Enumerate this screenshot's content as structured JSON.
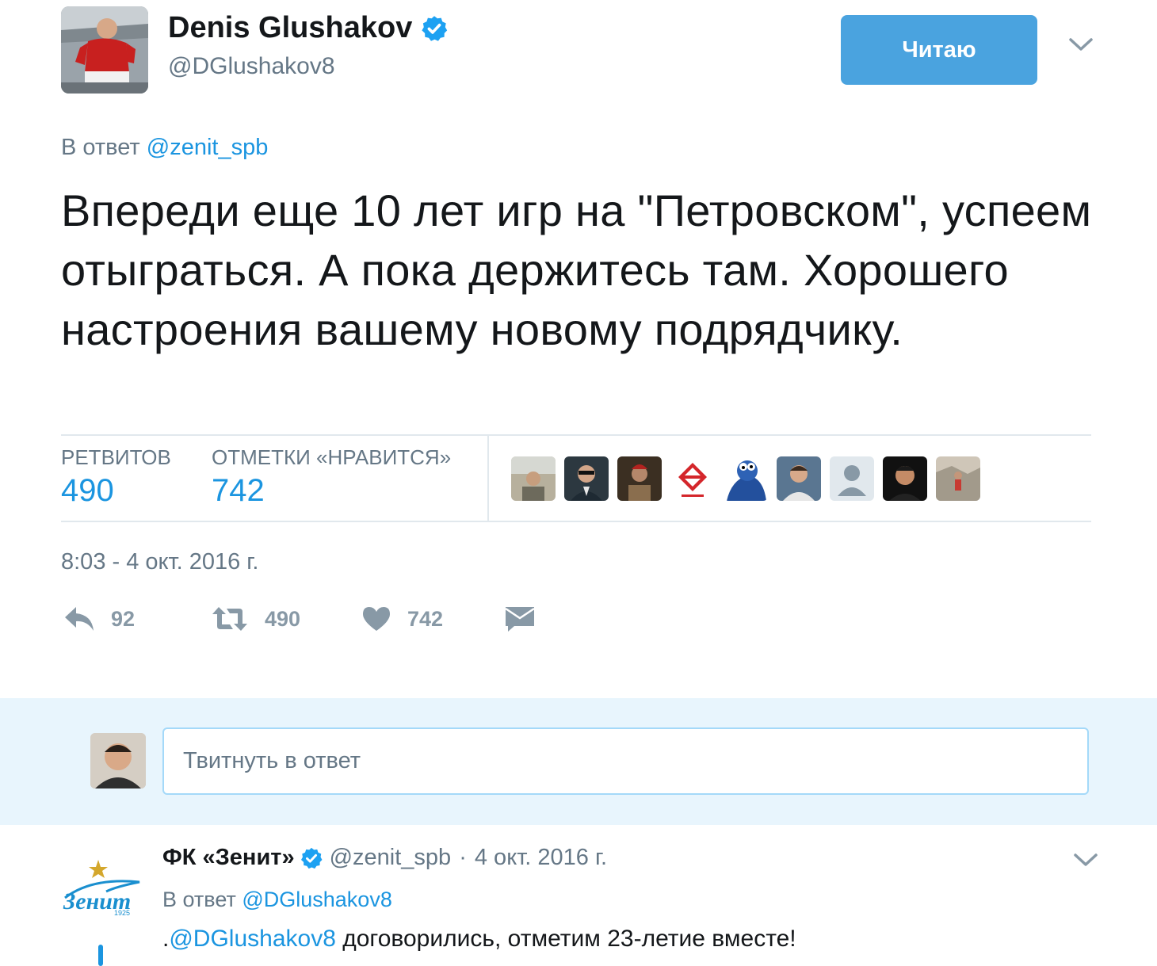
{
  "tweet": {
    "display_name": "Denis Glushakov",
    "handle": "@DGlushakov8",
    "follow_label": "Читаю",
    "reply_prefix": "В ответ",
    "reply_to_handle": "@zenit_spb",
    "text": "Впереди еще 10 лет игр на \"Петровском\", успеем отыграться. А пока держитесь там. Хорошего настроения вашему новому подрядчику.",
    "stats": {
      "retweets_label": "РЕТВИТОВ",
      "retweets_value": "490",
      "likes_label": "ОТМЕТКИ «НРАВИТСЯ»",
      "likes_value": "742"
    },
    "timestamp": "8:03 - 4 окт. 2016 г.",
    "actions": {
      "reply_count": "92",
      "retweet_count": "490",
      "like_count": "742"
    },
    "accent_color": "#1b95e0",
    "follow_color": "#4aa3df"
  },
  "composer": {
    "placeholder": "Твитнуть в ответ"
  },
  "reply": {
    "name": "ФК «Зенит»",
    "handle": "@zenit_spb",
    "separator": "·",
    "date": "4 окт. 2016 г.",
    "reply_prefix": "В ответ",
    "reply_to_handle": "@DGlushakov8",
    "text_prefix": ".",
    "text_mention": "@DGlushakov8",
    "text_rest": " договорились, отметим 23-летие вместе!",
    "logo_text": "Зенит",
    "logo_year": "1925"
  }
}
